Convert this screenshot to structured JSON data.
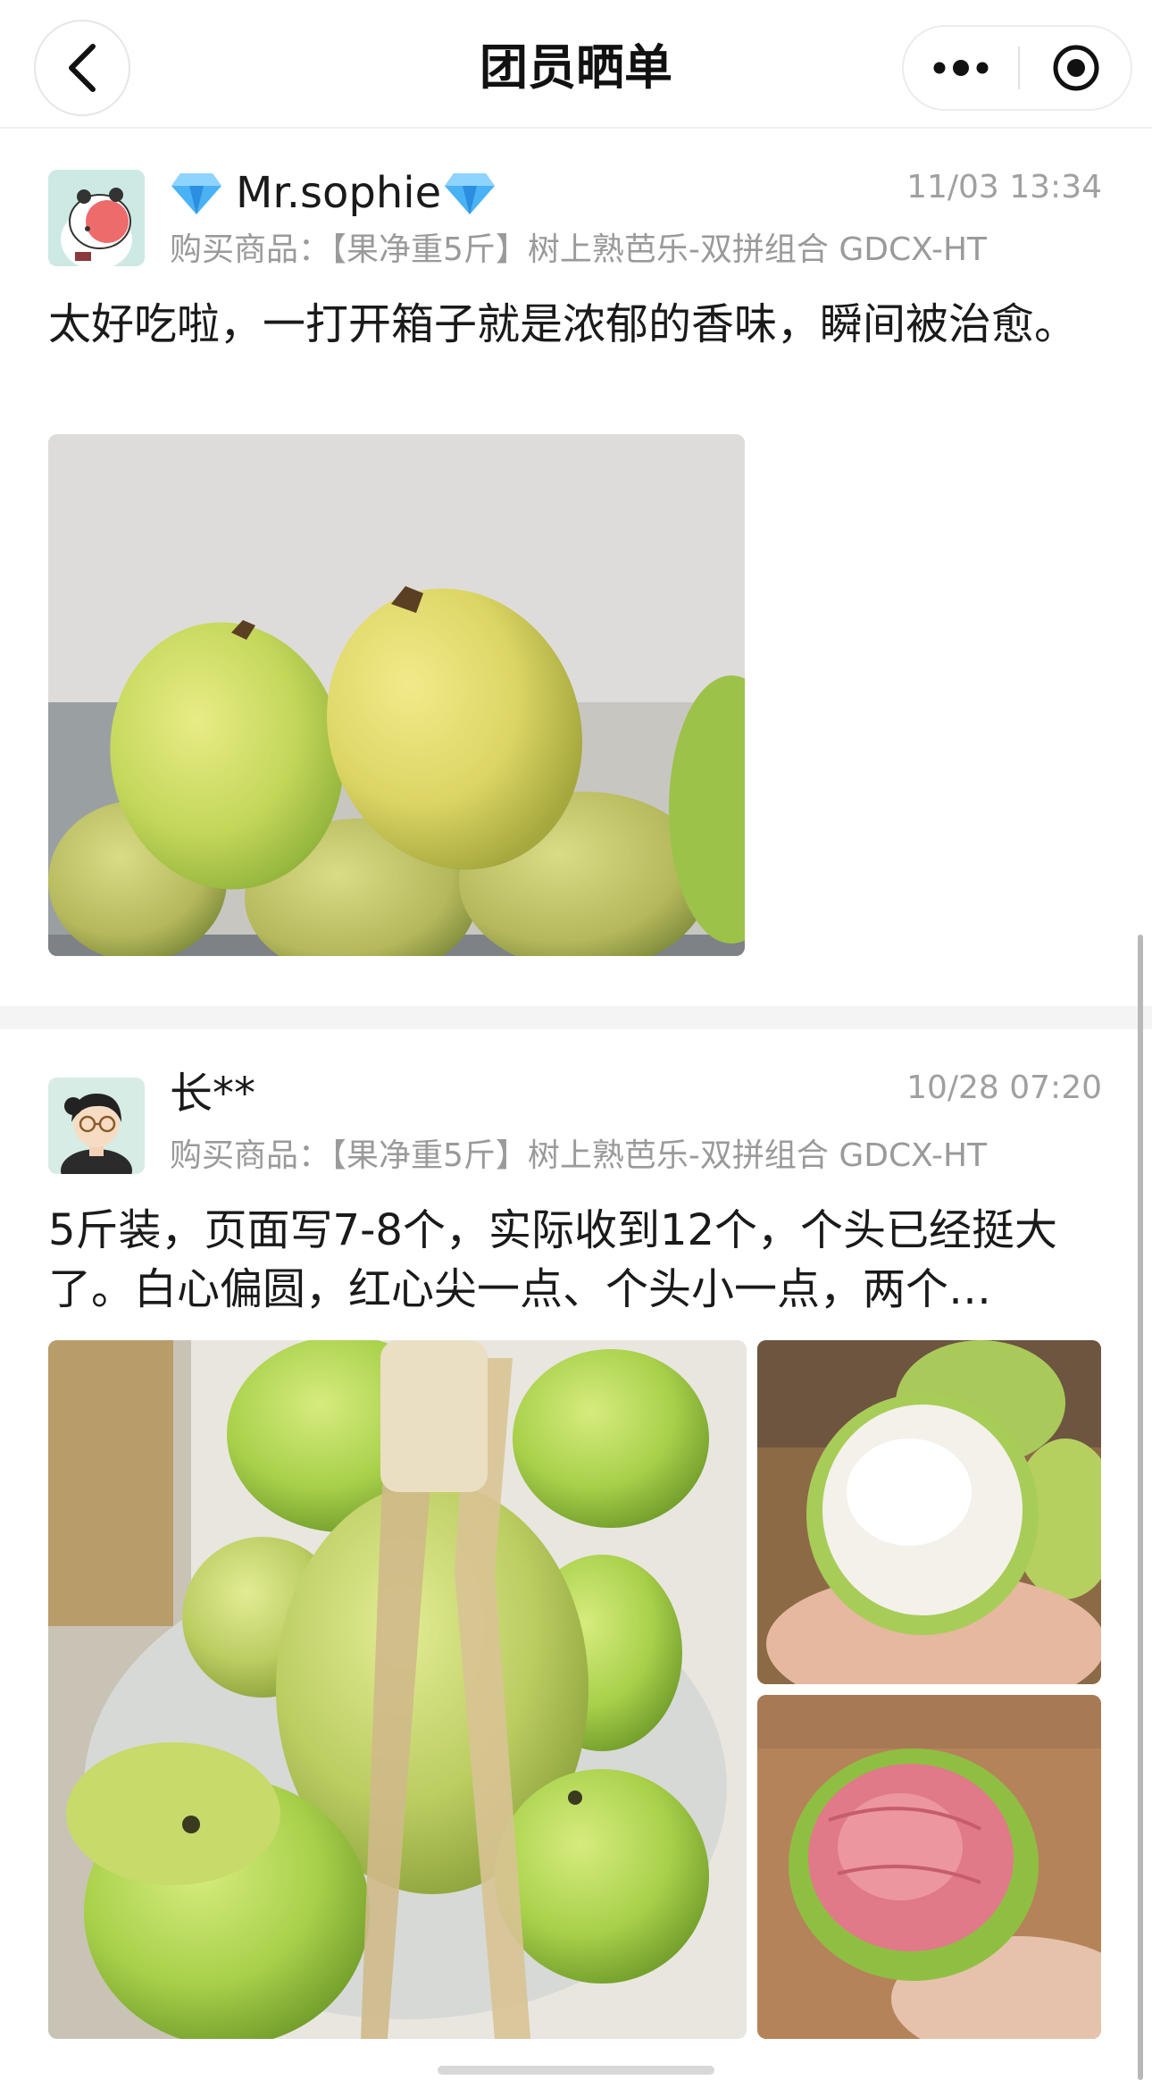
{
  "header": {
    "title": "团员晒单",
    "back_icon": "chevron-left-icon",
    "more_icon": "more-dots-icon",
    "target_icon": "target-icon"
  },
  "posts": [
    {
      "username": "Mr.sophie",
      "badge_icon": "diamond-icon",
      "timestamp": "11/03 13:34",
      "product_label": "购买商品：",
      "product_name": "【果净重5斤】树上熟芭乐-双拼组合 GDCX-HT",
      "review": "太好吃啦，一打开箱子就是浓郁的香味，瞬间被治愈。",
      "photos": [
        "guava-box-photo"
      ]
    },
    {
      "username": "长**",
      "timestamp": "10/28 07:20",
      "product_label": "购买商品：",
      "product_name": "【果净重5斤】树上熟芭乐-双拼组合 GDCX-HT",
      "review": "5斤装，页面写7-8个，实际收到12个，个头已经挺大了。白心偏圆，红心尖一点、个头小一点，两个…",
      "photos": [
        "guava-basket-photo",
        "white-guava-photo",
        "red-guava-photo"
      ]
    }
  ],
  "colors": {
    "guava_green": "#a9cf4c",
    "guava_yellow": "#dfe46a",
    "red_flesh": "#e07a88",
    "diamond": "#3aa0ef"
  }
}
